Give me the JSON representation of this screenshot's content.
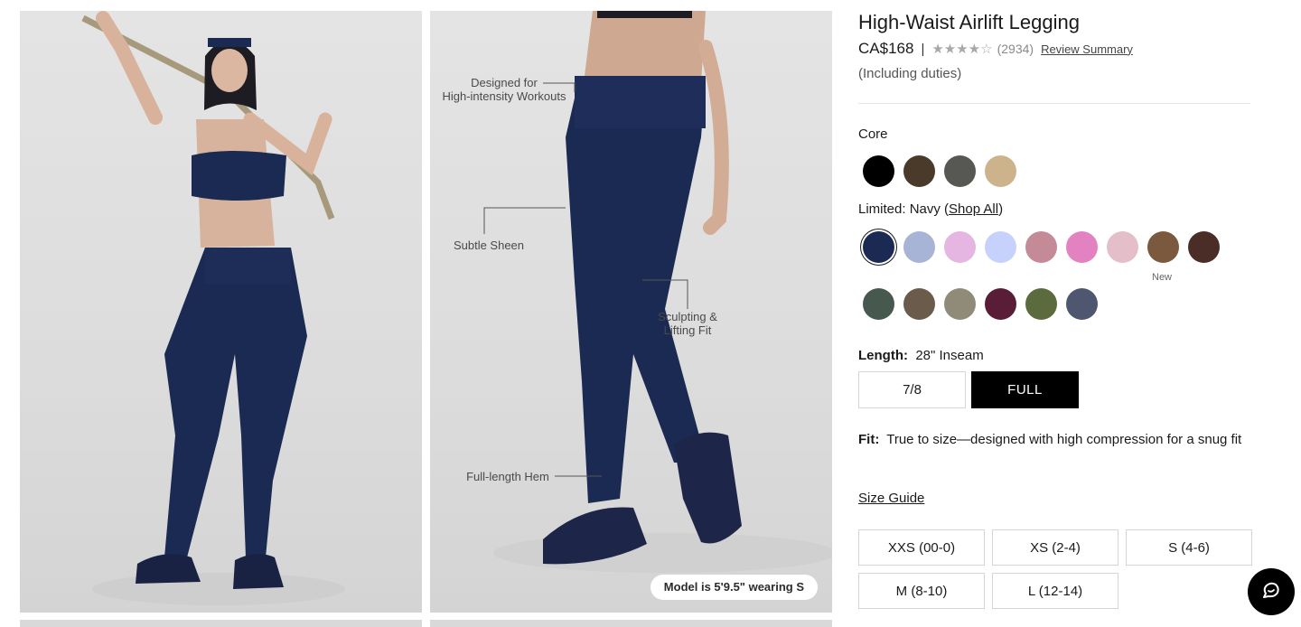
{
  "product": {
    "title": "High-Waist Airlift Legging",
    "price": "CA$168",
    "separator": "|",
    "rating": 4,
    "rating_max": 5,
    "review_count": "(2934)",
    "review_link": "Review Summary",
    "duties": "(Including duties)"
  },
  "colors": {
    "core_label": "Core",
    "core": [
      {
        "name": "Black",
        "hex": "#000000"
      },
      {
        "name": "Espresso",
        "hex": "#4a3a2a"
      },
      {
        "name": "Anthracite",
        "hex": "#575853"
      },
      {
        "name": "Tan",
        "hex": "#ccb38b"
      }
    ],
    "limited_prefix": "Limited: Navy (",
    "limited_link": "Shop All",
    "limited_suffix": ")",
    "limited": [
      {
        "name": "Navy",
        "hex": "#1b2a52",
        "selected": true
      },
      {
        "name": "Periwinkle",
        "hex": "#a7b4d6"
      },
      {
        "name": "Lilac",
        "hex": "#e6b6e2"
      },
      {
        "name": "Sky",
        "hex": "#c6d2fb"
      },
      {
        "name": "Mauve",
        "hex": "#c48a97"
      },
      {
        "name": "Pink",
        "hex": "#e382c1"
      },
      {
        "name": "Blush",
        "hex": "#e4bfca"
      },
      {
        "name": "Brown",
        "hex": "#7a593e",
        "tag": "New"
      },
      {
        "name": "Chocolate",
        "hex": "#4a2d26"
      },
      {
        "name": "Forest",
        "hex": "#47594f"
      },
      {
        "name": "Mocha",
        "hex": "#6b5b4a"
      },
      {
        "name": "Sage",
        "hex": "#908b78"
      },
      {
        "name": "Wine",
        "hex": "#5a1d37"
      },
      {
        "name": "Olive",
        "hex": "#5b6b3d"
      },
      {
        "name": "Slate",
        "hex": "#4e5670"
      }
    ]
  },
  "length": {
    "label": "Length:",
    "value": "28\" Inseam",
    "options": [
      "7/8",
      "FULL"
    ],
    "selected": "FULL"
  },
  "fit": {
    "label": "Fit:",
    "text": "True to size—designed with high compression for a snug fit"
  },
  "size_guide": "Size Guide",
  "sizes": [
    "XXS (00-0)",
    "XS (2-4)",
    "S (4-6)",
    "M (8-10)",
    "L (12-14)"
  ],
  "image2": {
    "callouts": {
      "workouts": "Designed for\nHigh-intensity Workouts",
      "sheen": "Subtle Sheen",
      "sculpting": "Sculpting &\nLifting Fit",
      "hem": "Full-length Hem"
    },
    "model_note": "Model is 5'9.5\" wearing S"
  },
  "chat": {
    "icon": "chat-icon"
  }
}
